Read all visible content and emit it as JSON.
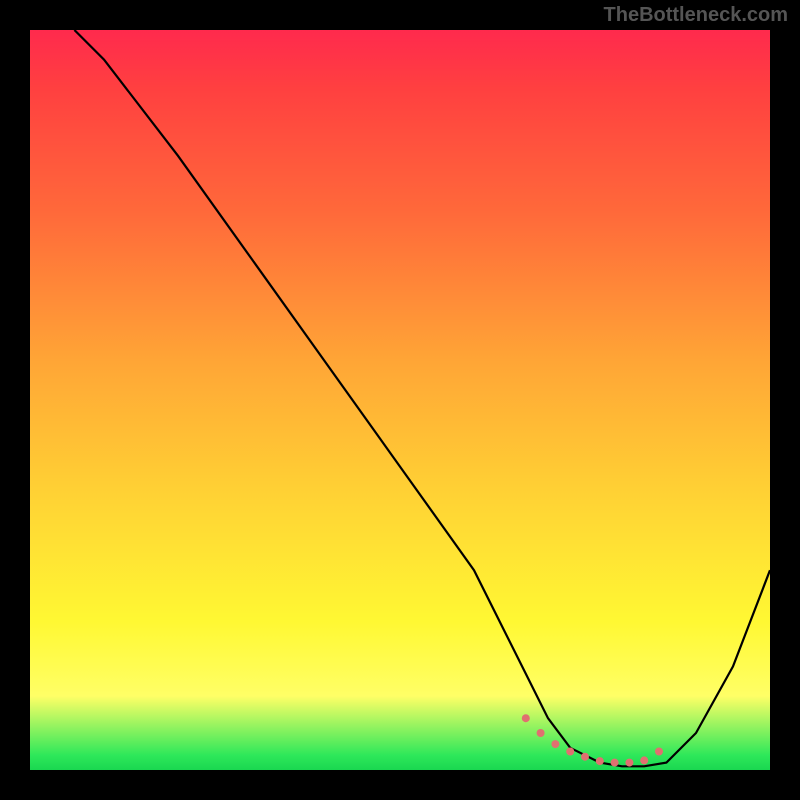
{
  "watermark": "TheBottleneck.com",
  "chart_data": {
    "type": "line",
    "title": "",
    "xlabel": "",
    "ylabel": "",
    "xlim": [
      0,
      100
    ],
    "ylim": [
      0,
      100
    ],
    "series": [
      {
        "name": "curve",
        "x": [
          6,
          10,
          20,
          30,
          40,
          50,
          60,
          67,
          70,
          73,
          77,
          80,
          83,
          86,
          90,
          95,
          100
        ],
        "y": [
          100,
          96,
          83,
          69,
          55,
          41,
          27,
          13,
          7,
          3,
          1,
          0.5,
          0.5,
          1,
          5,
          14,
          27
        ]
      }
    ],
    "markers": {
      "name": "valley-dots",
      "color": "#e07070",
      "x": [
        67,
        69,
        71,
        73,
        75,
        77,
        79,
        81,
        83,
        85
      ],
      "y": [
        7,
        5,
        3.5,
        2.5,
        1.8,
        1.2,
        1,
        1,
        1.3,
        2.5
      ]
    },
    "gradient_stops": [
      {
        "pos": 0,
        "color": "#ff2a4d"
      },
      {
        "pos": 25,
        "color": "#ff6a3a"
      },
      {
        "pos": 55,
        "color": "#ffc034"
      },
      {
        "pos": 85,
        "color": "#fff833"
      },
      {
        "pos": 98,
        "color": "#2ee85a"
      },
      {
        "pos": 100,
        "color": "#1ad750"
      }
    ]
  }
}
